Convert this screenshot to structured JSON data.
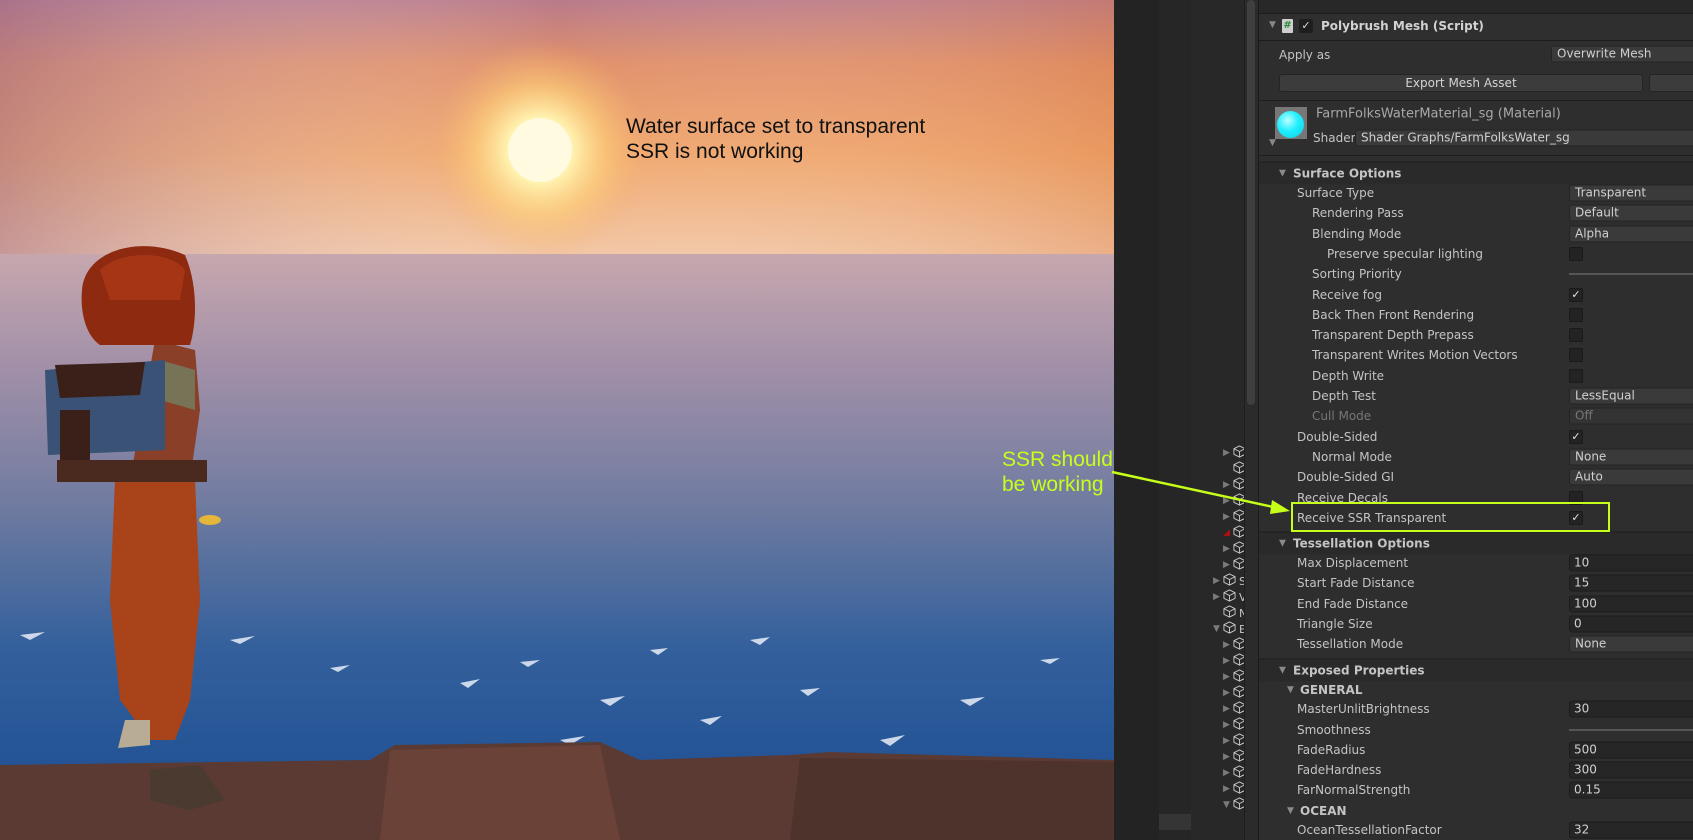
{
  "annotations": {
    "note_top": [
      "Water surface set to transparent",
      "SSR is not working"
    ],
    "note_side": [
      "SSR should",
      "be working"
    ],
    "highlight_color": "#c6ff1a"
  },
  "hierarchy": {
    "items": [
      {
        "label": "",
        "expand": "collapsed",
        "depth": 2
      },
      {
        "label": "",
        "expand": "none",
        "depth": 2
      },
      {
        "label": "",
        "expand": "collapsed",
        "depth": 2
      },
      {
        "label": "",
        "expand": "collapsed",
        "depth": 2
      },
      {
        "label": "",
        "expand": "collapsed",
        "depth": 2
      },
      {
        "label": "",
        "expand": "warning",
        "depth": 2
      },
      {
        "label": "",
        "expand": "collapsed",
        "depth": 2
      },
      {
        "label": "",
        "expand": "collapsed",
        "depth": 2
      },
      {
        "label": "S",
        "expand": "collapsed",
        "depth": 1
      },
      {
        "label": "V",
        "expand": "collapsed",
        "depth": 1
      },
      {
        "label": "N",
        "expand": "none",
        "depth": 1
      },
      {
        "label": "E",
        "expand": "expanded",
        "depth": 1
      },
      {
        "label": "",
        "expand": "collapsed",
        "depth": 2
      },
      {
        "label": "",
        "expand": "collapsed",
        "depth": 2
      },
      {
        "label": "",
        "expand": "collapsed",
        "depth": 2
      },
      {
        "label": "",
        "expand": "collapsed",
        "depth": 2
      },
      {
        "label": "",
        "expand": "collapsed",
        "depth": 2
      },
      {
        "label": "",
        "expand": "collapsed",
        "depth": 2
      },
      {
        "label": "",
        "expand": "collapsed",
        "depth": 2
      },
      {
        "label": "",
        "expand": "collapsed",
        "depth": 2
      },
      {
        "label": "",
        "expand": "collapsed",
        "depth": 2
      },
      {
        "label": "",
        "expand": "collapsed",
        "depth": 2
      },
      {
        "label": "",
        "expand": "expanded",
        "depth": 2
      }
    ]
  },
  "inspector": {
    "component": {
      "title": "Polybrush Mesh (Script)",
      "enabled": true,
      "icon": "script-hash-icon"
    },
    "apply_as": {
      "label": "Apply as",
      "value": "Overwrite Mesh"
    },
    "export_button": "Export Mesh Asset",
    "material": {
      "name": "FarmFolksWaterMaterial_sg (Material)",
      "shader_label": "Shader",
      "shader": "Shader Graphs/FarmFolksWater_sg",
      "preview_color": "#1ef0ff"
    },
    "rows": [
      {
        "type": "section",
        "label": "Surface Options"
      },
      {
        "type": "dropdown",
        "label": "Surface Type",
        "indent": 1,
        "value": "Transparent"
      },
      {
        "type": "dropdown",
        "label": "Rendering Pass",
        "indent": 2,
        "value": "Default"
      },
      {
        "type": "dropdown",
        "label": "Blending Mode",
        "indent": 2,
        "value": "Alpha"
      },
      {
        "type": "checkbox",
        "label": "Preserve specular lighting",
        "indent": 3,
        "checked": false
      },
      {
        "type": "slider",
        "label": "Sorting Priority",
        "indent": 2
      },
      {
        "type": "checkbox",
        "label": "Receive fog",
        "indent": 2,
        "checked": true
      },
      {
        "type": "checkbox",
        "label": "Back Then Front Rendering",
        "indent": 2,
        "checked": false
      },
      {
        "type": "checkbox",
        "label": "Transparent Depth Prepass",
        "indent": 2,
        "checked": false
      },
      {
        "type": "checkbox",
        "label": "Transparent Writes Motion Vectors",
        "indent": 2,
        "checked": false
      },
      {
        "type": "checkbox",
        "label": "Depth Write",
        "indent": 2,
        "checked": false
      },
      {
        "type": "dropdown",
        "label": "Depth Test",
        "indent": 2,
        "value": "LessEqual"
      },
      {
        "type": "dropdown",
        "label": "Cull Mode",
        "indent": 2,
        "value": "Off",
        "disabled": true
      },
      {
        "type": "checkbox",
        "label": "Double-Sided",
        "indent": 1,
        "checked": true
      },
      {
        "type": "dropdown",
        "label": "Normal Mode",
        "indent": 2,
        "value": "None"
      },
      {
        "type": "dropdown",
        "label": "Double-Sided GI",
        "indent": 1,
        "value": "Auto"
      },
      {
        "type": "checkbox",
        "label": "Receive Decals",
        "indent": 1,
        "checked": false
      },
      {
        "type": "checkbox",
        "label": "Receive SSR Transparent",
        "indent": 1,
        "checked": true
      },
      {
        "type": "section",
        "label": "Tessellation Options"
      },
      {
        "type": "number",
        "label": "Max Displacement",
        "indent": 1,
        "value": "10"
      },
      {
        "type": "number",
        "label": "Start Fade Distance",
        "indent": 1,
        "value": "15"
      },
      {
        "type": "number",
        "label": "End Fade Distance",
        "indent": 1,
        "value": "100"
      },
      {
        "type": "number",
        "label": "Triangle Size",
        "indent": 1,
        "value": "0"
      },
      {
        "type": "dropdown",
        "label": "Tessellation Mode",
        "indent": 1,
        "value": "None"
      },
      {
        "type": "section",
        "label": "Exposed Properties"
      },
      {
        "type": "subsection",
        "label": "GENERAL"
      },
      {
        "type": "number",
        "label": "MasterUnlitBrightness",
        "indent": 1,
        "value": "30"
      },
      {
        "type": "slider",
        "label": "Smoothness",
        "indent": 1
      },
      {
        "type": "number",
        "label": "FadeRadius",
        "indent": 1,
        "value": "500"
      },
      {
        "type": "number",
        "label": "FadeHardness",
        "indent": 1,
        "value": "300"
      },
      {
        "type": "number",
        "label": "FarNormalStrength",
        "indent": 1,
        "value": "0.15"
      },
      {
        "type": "subsection",
        "label": "OCEAN"
      },
      {
        "type": "number",
        "label": "OceanTessellationFactor",
        "indent": 1,
        "value": "32"
      }
    ]
  }
}
